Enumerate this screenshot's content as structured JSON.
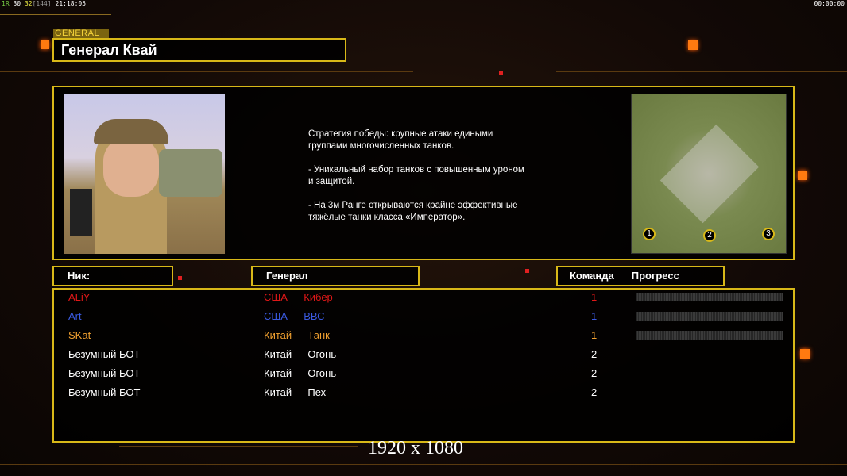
{
  "status": {
    "a": "1R",
    "b": "30",
    "c": "32",
    "d": "[144]",
    "time": "21:18:05"
  },
  "clock": "00:00:00",
  "tag": "GENERAL",
  "title": "Генерал Квай",
  "description": "Стратегия победы: крупные атаки едиными\n группами многочисленных танков.\n\n- Уникальный набор танков с повышенным уроном\n и защитой.\n\n- На 3м Ранге открываются крайне эффективные\n тяжёлые танки класса «Император».",
  "map": {
    "spawns": [
      "1",
      "2",
      "3"
    ]
  },
  "headers": {
    "nick": "Ник:",
    "general": "Генерал",
    "team": "Команда",
    "progress": "Прогресс"
  },
  "players": [
    {
      "nick": "ALiY",
      "general": "США — Кибер",
      "team": "1",
      "color": "#e01818",
      "progress": 0
    },
    {
      "nick": "Art",
      "general": "США — ВВС",
      "team": "1",
      "color": "#3a5ae0",
      "progress": 0
    },
    {
      "nick": "SKat",
      "general": "Китай — Танк",
      "team": "1",
      "color": "#f0a030",
      "progress": 0
    },
    {
      "nick": "Безумный БОТ",
      "general": "Китай — Огонь",
      "team": "2",
      "color": "#ffffff"
    },
    {
      "nick": "Безумный БОТ",
      "general": "Китай — Огонь",
      "team": "2",
      "color": "#ffffff"
    },
    {
      "nick": "Безумный БОТ",
      "general": "Китай — Пех",
      "team": "2",
      "color": "#ffffff"
    }
  ],
  "resolution": "1920 x 1080"
}
